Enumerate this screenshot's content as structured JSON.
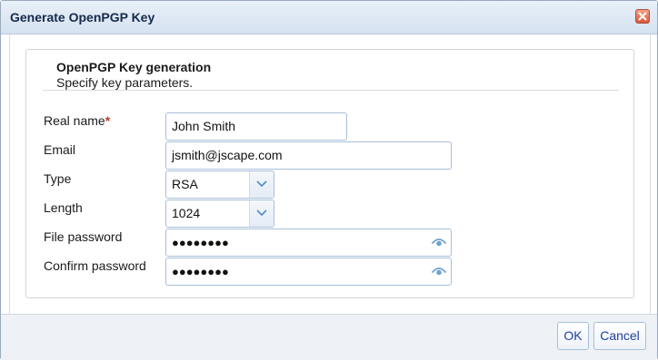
{
  "window": {
    "title": "Generate OpenPGP Key"
  },
  "panel": {
    "title": "OpenPGP Key generation",
    "subtitle": "Specify key parameters."
  },
  "form": {
    "real_name": {
      "label": "Real name",
      "required_marker": "*",
      "value": "John Smith"
    },
    "email": {
      "label": "Email",
      "value": "jsmith@jscape.com"
    },
    "type": {
      "label": "Type",
      "value": "RSA"
    },
    "length": {
      "label": "Length",
      "value": "1024"
    },
    "file_password": {
      "label": "File password",
      "masked_value": "●●●●●●●●"
    },
    "confirm_password": {
      "label": "Confirm password",
      "masked_value": "●●●●●●●●"
    }
  },
  "footer": {
    "ok_label": "OK",
    "cancel_label": "Cancel"
  },
  "icons": {
    "close": "close-icon",
    "dropdown": "chevron-down-icon",
    "reveal_password": "eye-icon"
  },
  "colors": {
    "title_text": "#15294b",
    "required": "#c0392b",
    "button_text": "#1f3f9f",
    "input_border": "#a8bfd9"
  }
}
